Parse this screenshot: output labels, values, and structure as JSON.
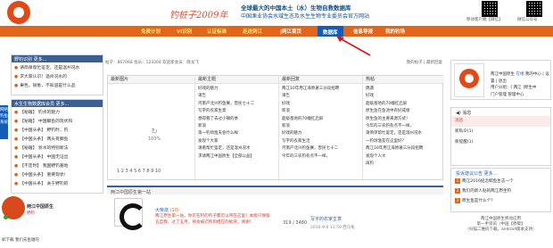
{
  "header": {
    "slogan": "钓桩子2009年",
    "motto_line1": "全球最大的中国本土（水）生物自救数据库",
    "motto_line2": "中国渔业协会水域生态及水生生物专业委员会官方网站",
    "qr_labels": [
      "移动客户端【微信】",
      "微信公众号"
    ]
  },
  "nav": {
    "items": [
      {
        "label": "免费计划"
      },
      {
        "label": "VI识别"
      },
      {
        "label": "认证标准"
      },
      {
        "label": "走进两江"
      },
      {
        "label": "|两江首页"
      },
      {
        "label": "数据库"
      },
      {
        "label": "信息导报"
      },
      {
        "label": "我的钓场"
      }
    ],
    "active_index": 5
  },
  "sidebar_tab": "网络钓鱼系统",
  "left_panels": [
    {
      "title": "野钓识别 更多...",
      "items": [
        "请简单帮忙鉴定，还是温州况水",
        "求大家认识！温州况水的",
        "果色，很象，不知道是什么品"
      ]
    },
    {
      "title": "水生生物数据库会员 更多...",
      "items": [
        "【秘籍】 钓点的魅力",
        "【秘籍】 中国鲫鱼的现状和",
        "【中国头条】 野钓时，钓",
        "【中国头条】 两头有鲫鱼",
        "【秘籍】 浙水的特别新法",
        "【中国头条】 中国无证出",
        "【不定时】 我国野钓基地",
        "【中国头条】 重要现状！",
        "【中国头条】 关于野钓的"
      ]
    }
  ],
  "stats": {
    "text": "帖子：867068  会员：123204  欢迎新会员：晓龙飞",
    "links": "我的帖子 | 最新回复"
  },
  "center": {
    "columns": [
      {
        "title": "最新图片",
        "items": []
      },
      {
        "title": "最新主题",
        "items": [
          "好戏的魅力",
          "请告",
          "河南产北兴钓鱼赛，曾民七十二",
          "写字的农家生意",
          "想得看了去过小镇的季",
          "新浪",
          "第一钓场渔夫会什么样",
          "发现个大家",
          "请看帮忙鉴定，还是温州况水",
          "求请两江中国原生【全部公益】"
        ]
      },
      {
        "title": "最新回复",
        "items": [
          "两江10年用江海原著三分段招聘",
          "请告",
          "好戏",
          "新浪",
          "超级基地的70幢红启屏",
          "新浪",
          "好戏的魅力",
          "写字的农家生活",
          "河南产北兴钓鱼赛，曾民七十二",
          "今年的三农钓有点不一样，"
        ]
      },
      {
        "title": "热帖",
        "items": [
          "偶遇",
          "好戏",
          "超级基地的70幢红启屏",
          "原生鱼在鱼池中有好成绩",
          "原生鱼的主要来源方式！",
          "今年的三农钓有点不一样，",
          "请简单帮忙鉴定，还是温州况水",
          "一钓场渔友在这里好？",
          "两江10年用江海原著三分段招聘",
          "发现个人大",
          "再钓"
        ]
      }
    ],
    "loader_pct": "100%",
    "pager": "1 2 3 4 5 6 7 8 9 10"
  },
  "band": {
    "title": "两江中国原生第一站"
  },
  "post": {
    "user": "大柴烧",
    "level": "(10)",
    "text": "两江原生第一站，你可在钓的钓子都可以带在这里！本版只保留五自我，过了五月，将会被迁移到相应的板块，谢谢！",
    "counts": "319 / 3480",
    "link": "写字的农家生意",
    "date": "2016-9-6 11:59  西乌龟"
  },
  "user_card": {
    "name": "两江中国原生",
    "tag": "在线",
    "links": [
      "我的中心",
      "设置",
      "退出"
    ],
    "line2": "用户分组：[ 两江 ]原生中",
    "line3": "门户管理   管理中心"
  },
  "messages": {
    "title": "消息",
    "items": [
      "消息",
      "新私众(1)",
      "新提醒(1)"
    ]
  },
  "announcements": {
    "title": "投诉建议公告 更多...",
    "items": [
      {
        "num": "1",
        "text": "两江2016纪念鲸鱼生志一个"
      },
      {
        "num": "2",
        "text": "我们的新人贴的两江原生钓"
      },
      {
        "num": "3",
        "text": "原生鱼是什么个？"
      }
    ]
  },
  "right_footer": {
    "line1": "两江中国原生移动应用",
    "line2": "第一手资讯（中国【原版】",
    "line3": "（扫描二维码下载，android版本支持）"
  },
  "float_ad": {
    "title": "两江中国原生",
    "subtitle": "野钓",
    "caption": "如下载   我们去鱼塘的"
  },
  "colors": {
    "nav_bg": "#e36517",
    "nav_active": "#135db7",
    "panel_head": "#3b5f95",
    "accent_red": "#d23b2c",
    "link_blue": "#2a62b3"
  }
}
